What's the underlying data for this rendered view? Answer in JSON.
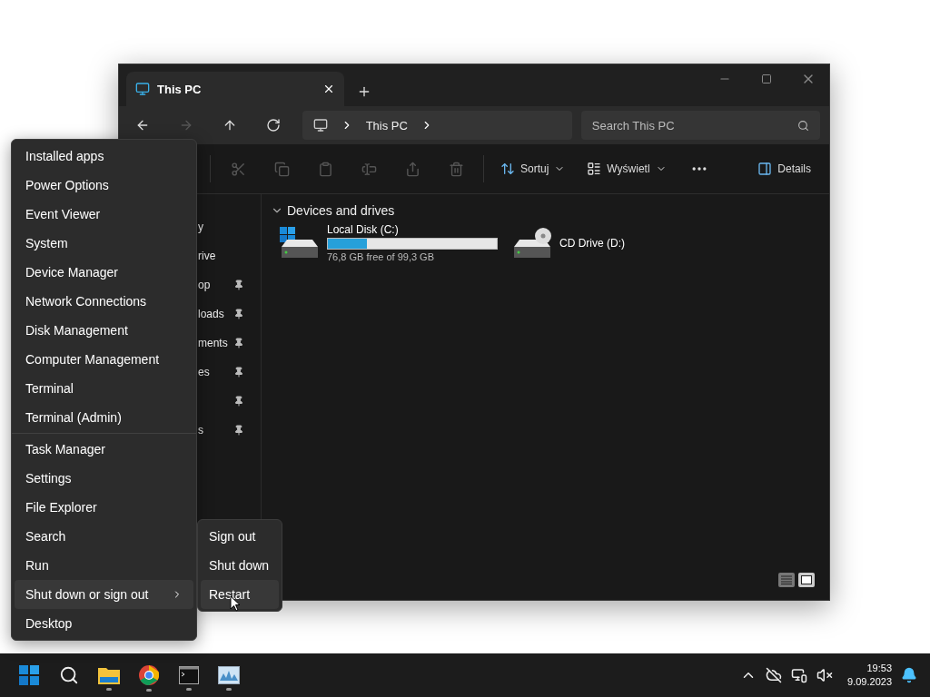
{
  "window": {
    "tabs": [
      {
        "label": "This PC",
        "selected": true
      }
    ],
    "nav": [
      {
        "kind": "back",
        "disabled": false
      },
      {
        "kind": "forward",
        "disabled": true
      },
      {
        "kind": "up",
        "disabled": false
      },
      {
        "kind": "refresh",
        "disabled": false
      }
    ],
    "breadcrumb": [
      "This PC"
    ],
    "search": {
      "placeholder": "Search This PC"
    },
    "toolbar": [
      {
        "kind": "cut",
        "disabled": true
      },
      {
        "kind": "copy",
        "disabled": true
      },
      {
        "kind": "paste",
        "disabled": true
      },
      {
        "kind": "rename",
        "disabled": true
      },
      {
        "kind": "share",
        "disabled": true
      },
      {
        "kind": "delete",
        "disabled": true
      }
    ],
    "sort": {
      "label": "Sortuj"
    },
    "view": {
      "label": "Wyświetl"
    },
    "details": {
      "label": "Details"
    },
    "sidebar": {
      "items": [
        {
          "label": "y",
          "pinned": false
        },
        {
          "label": "rive",
          "pinned": false
        },
        {
          "label": "op",
          "pinned": true
        },
        {
          "label": "loads",
          "pinned": true
        },
        {
          "label": "ments",
          "pinned": true
        },
        {
          "label": "es",
          "pinned": true
        },
        {
          "pinned": true
        },
        {
          "label": "s",
          "pinned": true
        }
      ]
    },
    "section": {
      "title": "Devices and drives",
      "expanded": true
    },
    "drives": [
      {
        "kind": "disk",
        "name": "Local Disk (C:)",
        "level": 0.23,
        "info": "76,8 GB free of 99,3 GB"
      },
      {
        "kind": "cd",
        "name": "CD Drive (D:)"
      }
    ],
    "status_bar": {
      "views": [
        {
          "kind": "details",
          "selected": false
        },
        {
          "kind": "large",
          "selected": true
        }
      ]
    }
  },
  "context_menu": {
    "groups": [
      {
        "items": [
          {
            "label": "Installed apps",
            "submenu": false,
            "expanded": false
          },
          {
            "label": "Power Options",
            "submenu": false,
            "expanded": false
          },
          {
            "label": "Event Viewer",
            "submenu": false,
            "expanded": false
          },
          {
            "label": "System",
            "submenu": false,
            "expanded": false
          },
          {
            "label": "Device Manager",
            "submenu": false,
            "expanded": false
          },
          {
            "label": "Network Connections",
            "submenu": false,
            "expanded": false
          },
          {
            "label": "Disk Management",
            "submenu": false,
            "expanded": false
          },
          {
            "label": "Computer Management",
            "submenu": false,
            "expanded": false
          },
          {
            "label": "Terminal",
            "submenu": false,
            "expanded": false
          },
          {
            "label": "Terminal (Admin)",
            "submenu": false,
            "expanded": false
          }
        ]
      },
      {
        "items": [
          {
            "label": "Task Manager",
            "submenu": false,
            "expanded": false
          },
          {
            "label": "Settings",
            "submenu": false,
            "expanded": false
          },
          {
            "label": "File Explorer",
            "submenu": false,
            "expanded": false
          },
          {
            "label": "Search",
            "submenu": false,
            "expanded": false
          },
          {
            "label": "Run",
            "submenu": false,
            "expanded": false
          },
          {
            "label": "Shut down or sign out",
            "submenu": true,
            "expanded": true
          },
          {
            "label": "Desktop",
            "submenu": false,
            "expanded": false
          }
        ]
      }
    ]
  },
  "submenu": {
    "items": [
      {
        "label": "Sign out",
        "selected": false
      },
      {
        "label": "Shut down",
        "selected": false
      },
      {
        "label": "Restart",
        "selected": true
      }
    ]
  },
  "taskbar": {
    "apps": [
      {
        "kind": "start",
        "running": false
      },
      {
        "kind": "search",
        "running": false
      },
      {
        "kind": "explorer",
        "running": true
      },
      {
        "kind": "browser",
        "running": true
      },
      {
        "kind": "terminal",
        "running": true
      },
      {
        "kind": "monitor",
        "running": true
      }
    ],
    "tray": [
      {
        "kind": "chevron"
      },
      {
        "kind": "cloud"
      },
      {
        "kind": "network"
      },
      {
        "kind": "volume"
      }
    ],
    "time": "19:53",
    "date": "9.09.2023"
  }
}
